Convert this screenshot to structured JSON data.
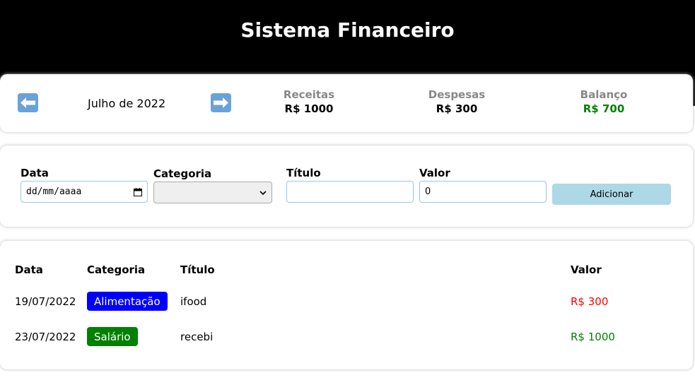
{
  "header": {
    "title": "Sistema Financeiro"
  },
  "info": {
    "month": "Julho de 2022",
    "prev_icon": "arrow-left-icon",
    "next_icon": "arrow-right-icon",
    "resume": [
      {
        "label": "Receitas",
        "value": "R$ 1000",
        "color": "#000000"
      },
      {
        "label": "Despesas",
        "value": "R$ 300",
        "color": "#000000"
      },
      {
        "label": "Balanço",
        "value": "R$ 700",
        "color": "#008000"
      }
    ]
  },
  "form": {
    "date": {
      "label": "Data",
      "placeholder": "dd/mm/aaaa"
    },
    "category": {
      "label": "Categoria",
      "value": ""
    },
    "title": {
      "label": "Título",
      "value": ""
    },
    "value": {
      "label": "Valor",
      "value": "0"
    },
    "add_label": "Adicionar"
  },
  "table": {
    "headers": {
      "date": "Data",
      "category": "Categoria",
      "title": "Título",
      "value": "Valor"
    },
    "rows": [
      {
        "date": "19/07/2022",
        "category": "Alimentação",
        "category_color": "#0000ff",
        "title": "ifood",
        "value": "R$ 300",
        "value_color": "#ff0000"
      },
      {
        "date": "23/07/2022",
        "category": "Salário",
        "category_color": "#008000",
        "title": "recebi",
        "value": "R$ 1000",
        "value_color": "#008000"
      }
    ]
  }
}
